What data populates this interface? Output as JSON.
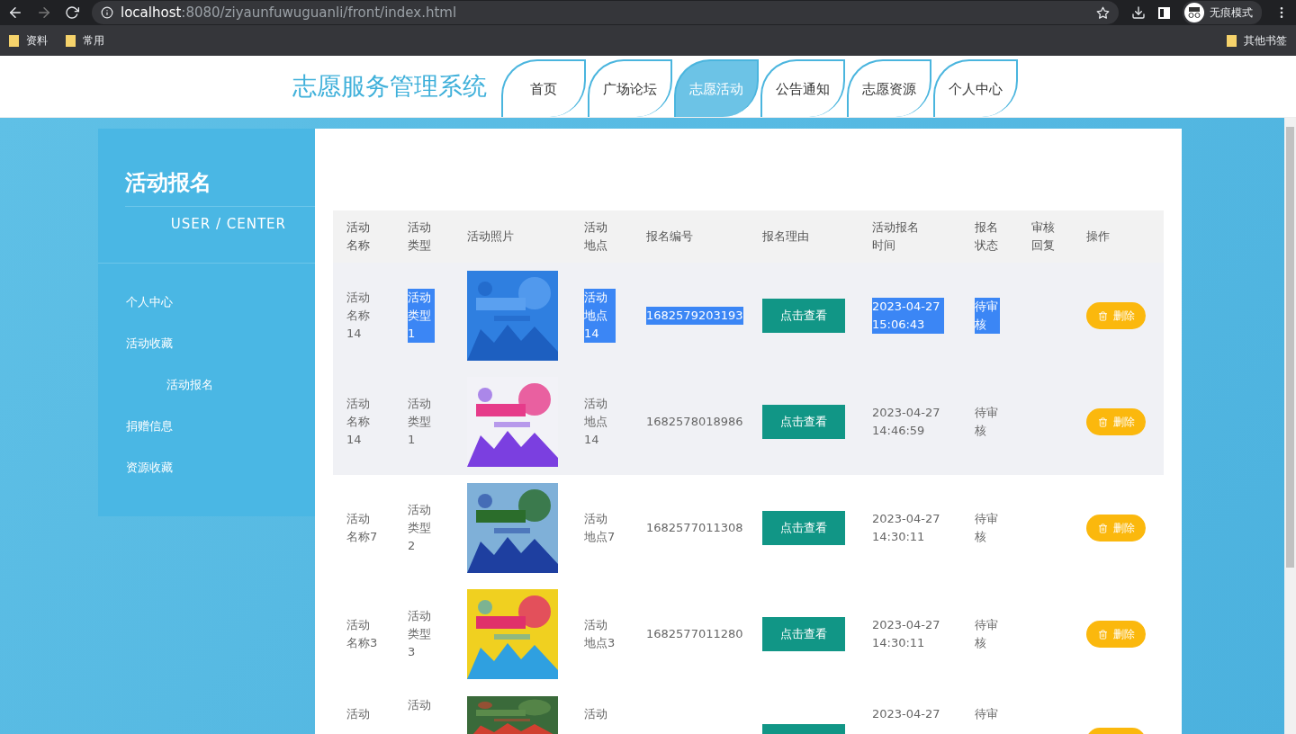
{
  "browser": {
    "url_host": "localhost",
    "url_rest": ":8080/ziyaunfuwuguanli/front/index.html",
    "profile": "无痕模式",
    "bookmarks": [
      "资料",
      "常用"
    ],
    "other_bookmarks": "其他书签"
  },
  "header": {
    "title": "志愿服务管理系统",
    "nav": [
      {
        "label": "首页",
        "selected": false
      },
      {
        "label": "广场论坛",
        "selected": false
      },
      {
        "label": "志愿活动",
        "selected": true
      },
      {
        "label": "公告通知",
        "selected": false
      },
      {
        "label": "志愿资源",
        "selected": false
      },
      {
        "label": "个人中心",
        "selected": false
      }
    ]
  },
  "sidebar": {
    "title": "活动报名",
    "subtitle": "USER / CENTER",
    "items": [
      {
        "label": "个人中心"
      },
      {
        "label": "活动收藏",
        "children": [
          {
            "label": "活动报名"
          }
        ]
      },
      {
        "label": "捐赠信息"
      },
      {
        "label": "资源收藏"
      }
    ]
  },
  "table": {
    "columns": [
      "活动名称",
      "活动类型",
      "活动照片",
      "活动地点",
      "报名编号",
      "报名理由",
      "活动报名时间",
      "报名状态",
      "审核回复",
      "操作"
    ],
    "rows": [
      {
        "name": "活动名称14",
        "type": "活动类型1",
        "location": "活动地点14",
        "number": "1682579203193",
        "view": "点击查看",
        "time": "2023-04-27 15:06:43",
        "status": "待审核",
        "delete": "删除",
        "shaded": true,
        "text_selected": true
      },
      {
        "name": "活动名称14",
        "type": "活动类型1",
        "location": "活动地点14",
        "number": "1682578018986",
        "view": "点击查看",
        "time": "2023-04-27 14:46:59",
        "status": "待审核",
        "delete": "删除",
        "shaded": true,
        "text_selected": false
      },
      {
        "name": "活动名称7",
        "type": "活动类型2",
        "location": "活动地点7",
        "number": "1682577011308",
        "view": "点击查看",
        "time": "2023-04-27 14:30:11",
        "status": "待审核",
        "delete": "删除",
        "shaded": false,
        "text_selected": false
      },
      {
        "name": "活动名称3",
        "type": "活动类型3",
        "location": "活动地点3",
        "number": "1682577011280",
        "view": "点击查看",
        "time": "2023-04-27 14:30:11",
        "status": "待审核",
        "delete": "删除",
        "shaded": false,
        "text_selected": false
      }
    ],
    "cut_row": {
      "name": "活动",
      "type": "活动",
      "location": "活动",
      "time": "2023-04-27",
      "status": "待审"
    }
  }
}
